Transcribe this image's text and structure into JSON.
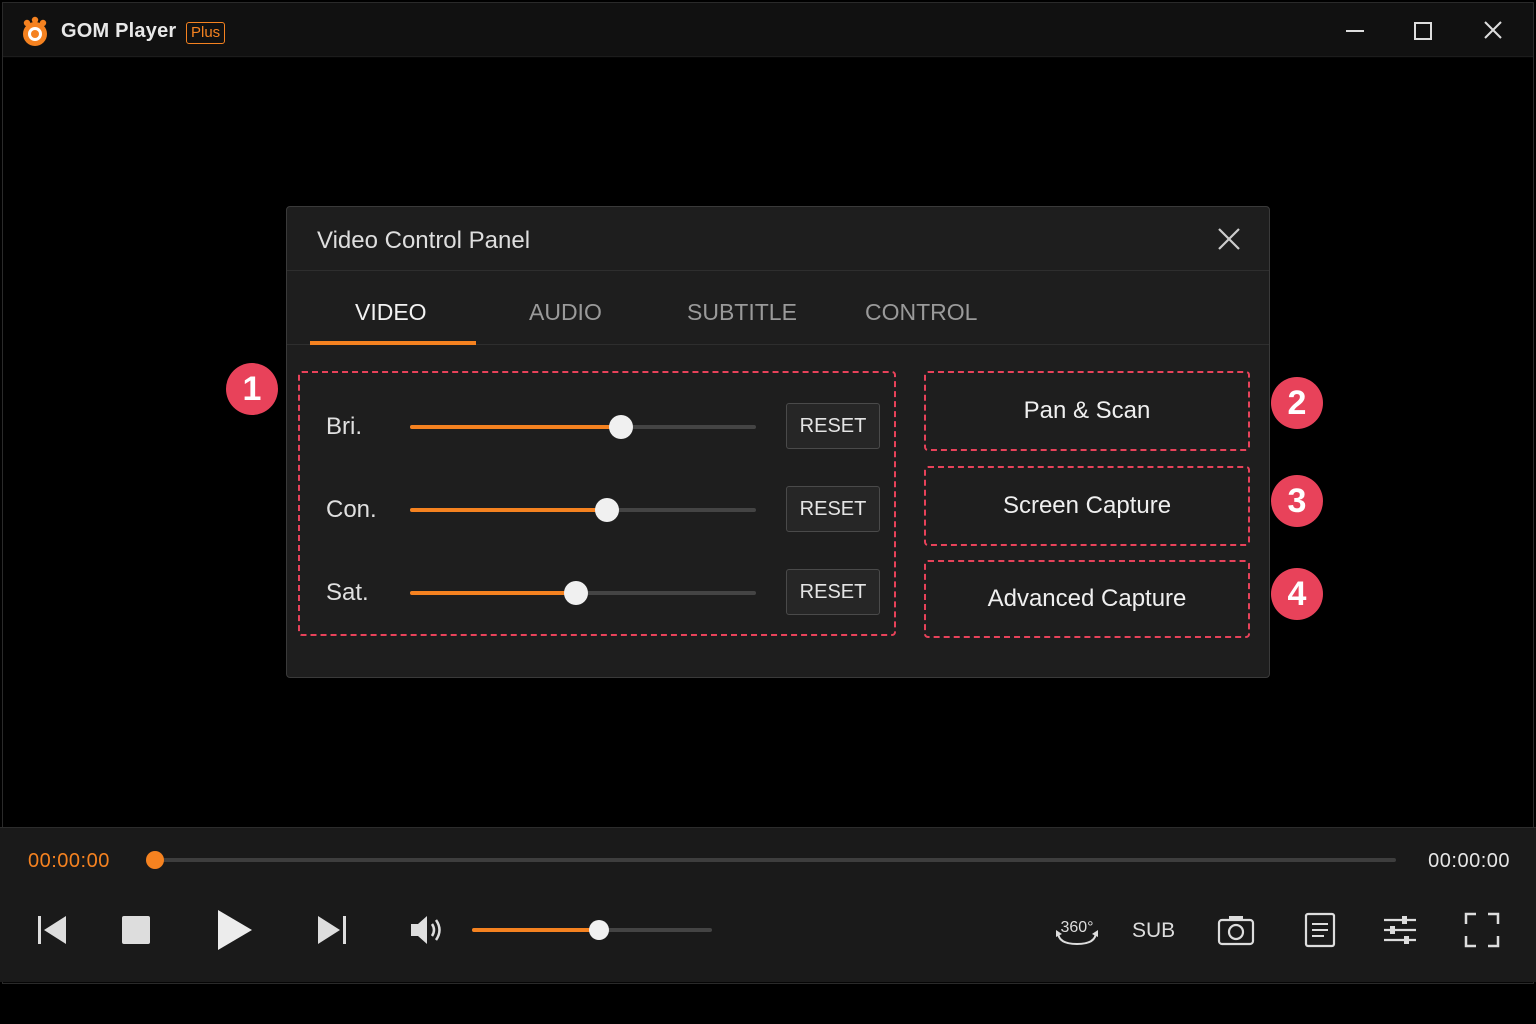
{
  "app": {
    "name": "GOM Player",
    "badge": "Plus",
    "accent_color": "#f58220"
  },
  "window_controls": [
    "minimize-icon",
    "maximize-icon",
    "close-icon"
  ],
  "panel": {
    "title": "Video Control Panel",
    "tabs": [
      {
        "label": "VIDEO",
        "active": true
      },
      {
        "label": "AUDIO",
        "active": false
      },
      {
        "label": "SUBTITLE",
        "active": false
      },
      {
        "label": "CONTROL",
        "active": false
      }
    ],
    "sliders": [
      {
        "label": "Bri.",
        "value_fraction": 0.61,
        "reset_label": "RESET"
      },
      {
        "label": "Con.",
        "value_fraction": 0.57,
        "reset_label": "RESET"
      },
      {
        "label": "Sat.",
        "value_fraction": 0.48,
        "reset_label": "RESET"
      }
    ],
    "actions": [
      {
        "label": "Pan & Scan"
      },
      {
        "label": "Screen Capture"
      },
      {
        "label": "Advanced Capture"
      }
    ],
    "markers": [
      "1",
      "2",
      "3",
      "4"
    ],
    "highlight_color": "#e8425a"
  },
  "playback": {
    "current_time": "00:00:00",
    "total_time": "00:00:00",
    "seek_fraction": 0.0,
    "volume_fraction": 0.53,
    "sub_label": "SUB",
    "icons": [
      "prev-icon",
      "stop-icon",
      "play-icon",
      "next-icon",
      "volume-icon",
      "360-icon",
      "camera-icon",
      "playlist-icon",
      "equalizer-icon",
      "fullscreen-icon"
    ]
  }
}
